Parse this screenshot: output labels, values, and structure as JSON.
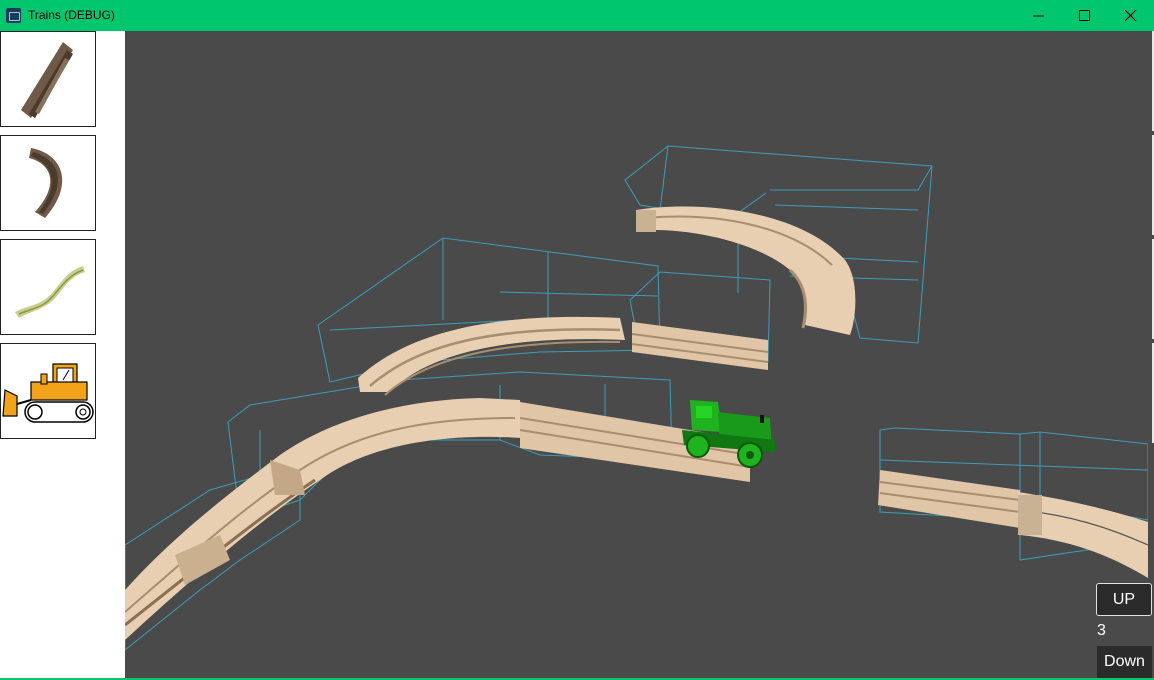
{
  "window": {
    "title": "Trains (DEBUG)",
    "icon": "train-app-icon",
    "accent": "#00c76e"
  },
  "toolbox": {
    "items": [
      {
        "name": "straight-track",
        "icon": "straight-track-icon"
      },
      {
        "name": "curved-track",
        "icon": "curved-track-icon"
      },
      {
        "name": "ramp-track",
        "icon": "ramp-track-icon"
      },
      {
        "name": "bulldozer",
        "icon": "bulldozer-icon"
      }
    ]
  },
  "level_controls": {
    "up_label": "UP",
    "level": "3",
    "down_label": "Down"
  },
  "scene": {
    "background": "#4a4a4a",
    "track_color": "#e8cfb2",
    "bbox_color": "#3aa7c9",
    "train_color": "#1fb41f"
  }
}
